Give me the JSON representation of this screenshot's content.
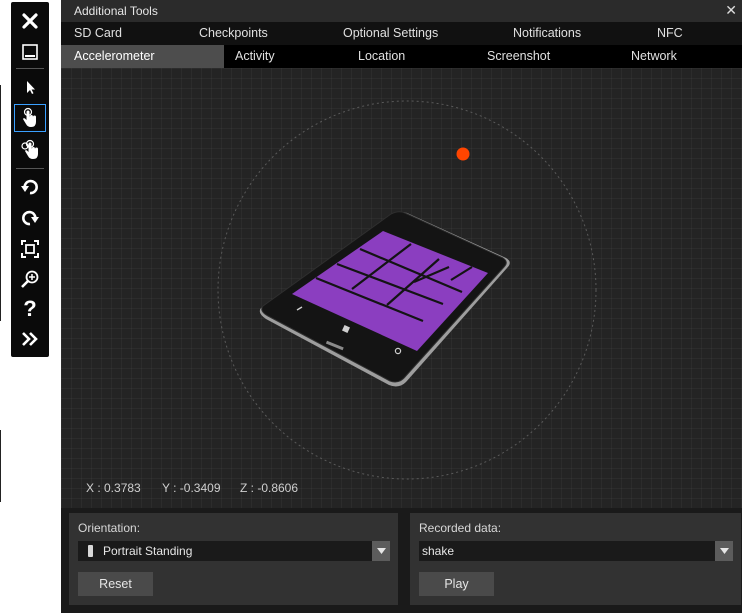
{
  "window": {
    "title": "Additional Tools"
  },
  "tabs_row1": [
    "SD Card",
    "Checkpoints",
    "Optional Settings",
    "Notifications",
    "NFC"
  ],
  "tabs_row2": [
    "Accelerometer",
    "Activity",
    "Location",
    "Screenshot",
    "Network"
  ],
  "active_tab": "Accelerometer",
  "readouts": {
    "x": "X : 0.3783",
    "y": "Y : -0.3409",
    "z": "Z : -0.8606"
  },
  "orientation": {
    "label": "Orientation:",
    "selected": "Portrait Standing",
    "reset_label": "Reset"
  },
  "recorded": {
    "label": "Recorded data:",
    "selected": "shake",
    "play_label": "Play"
  },
  "toolbar": [
    "close-icon",
    "minimize-icon",
    "arrow-pointer-icon",
    "single-touch-icon",
    "multi-touch-icon",
    "rotate-left-icon",
    "rotate-right-icon",
    "fit-screen-icon",
    "zoom-icon",
    "help-icon",
    "tools-icon"
  ],
  "colors": {
    "accent_dot": "#ff4500",
    "tile_purple": "#8b3ec0",
    "selected_border": "#3aa0ff"
  }
}
